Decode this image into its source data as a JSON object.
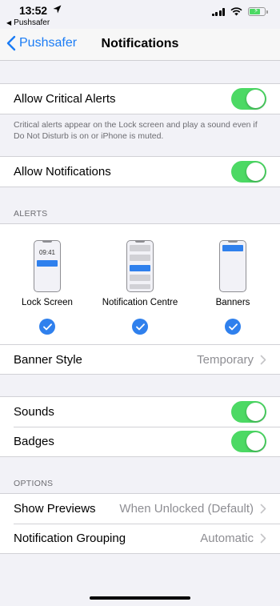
{
  "status_bar": {
    "time": "13:52",
    "back_app": "Pushsafer"
  },
  "nav": {
    "back_label": "Pushsafer",
    "title": "Notifications"
  },
  "critical": {
    "label": "Allow Critical Alerts",
    "enabled": true,
    "footnote": "Critical alerts appear on the Lock screen and play a sound even if Do Not Disturb is on or iPhone is muted."
  },
  "allow_notifications": {
    "label": "Allow Notifications",
    "enabled": true
  },
  "alerts": {
    "header": "ALERTS",
    "styles": [
      {
        "label": "Lock Screen",
        "checked": true,
        "preview_time": "09:41"
      },
      {
        "label": "Notification Centre",
        "checked": true
      },
      {
        "label": "Banners",
        "checked": true
      }
    ],
    "banner_style": {
      "label": "Banner Style",
      "value": "Temporary"
    }
  },
  "sounds": {
    "label": "Sounds",
    "enabled": true
  },
  "badges": {
    "label": "Badges",
    "enabled": true
  },
  "options": {
    "header": "OPTIONS",
    "show_previews": {
      "label": "Show Previews",
      "value": "When Unlocked (Default)"
    },
    "grouping": {
      "label": "Notification Grouping",
      "value": "Automatic"
    }
  },
  "colors": {
    "accent": "#1a7cf5",
    "toggle_on": "#4cd964",
    "check": "#2f80ed",
    "background": "#f2f2f7"
  }
}
